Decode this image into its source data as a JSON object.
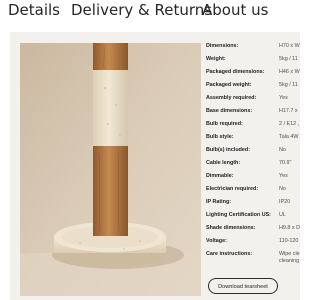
{
  "tabs": [
    {
      "label": "Details"
    },
    {
      "label": "Delivery & Returns"
    },
    {
      "label": "About us"
    }
  ],
  "product_image": {
    "alt": "Wood and stone lamp base on a round travertine plinth"
  },
  "specs": [
    {
      "label": "Dimensions:",
      "value": "H70 x W"
    },
    {
      "label": "Weight:",
      "value": "5kg / 11"
    },
    {
      "label": "Packaged dimensions:",
      "value": "H46 x W"
    },
    {
      "label": "Packaged weight:",
      "value": "5kg / 11"
    },
    {
      "label": "Assembly required:",
      "value": "Yes"
    },
    {
      "label": "Base dimensions:",
      "value": "H17.7 x"
    },
    {
      "label": "Bulb required:",
      "value": "2 / E12 ,"
    },
    {
      "label": "Bulb style:",
      "value": "Tala 4W"
    },
    {
      "label": "Bulb(s) included:",
      "value": "No"
    },
    {
      "label": "Cable length:",
      "value": "70.9\""
    },
    {
      "label": "Dimmable:",
      "value": "Yes"
    },
    {
      "label": "Electrician required:",
      "value": "No"
    },
    {
      "label": "IP Rating:",
      "value": "IP20"
    },
    {
      "label": "Lighting Certification US:",
      "value": "UL"
    },
    {
      "label": "Shade dimensions:",
      "value": "H9.8 x D"
    },
    {
      "label": "Voltage:",
      "value": "110-120"
    },
    {
      "label": "Care instructions:",
      "value": "Wipe cle",
      "value_line2": "cleaning"
    }
  ],
  "download_button": {
    "label": "Download tearsheet"
  },
  "colors": {
    "panel_bg": "#f3f1ee",
    "wall": "#d7c8b4",
    "wood": "#b07a45",
    "travertine": "#ece0cb"
  }
}
